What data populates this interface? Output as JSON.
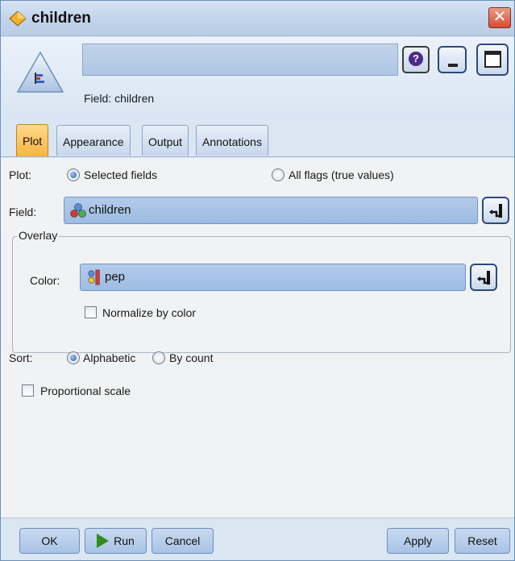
{
  "window": {
    "title": "children",
    "close_label": "✕"
  },
  "header": {
    "node_name_value": "",
    "help_label": "?",
    "field_caption": "Field: children"
  },
  "tabs": [
    {
      "label": "Plot",
      "active": true
    },
    {
      "label": "Appearance",
      "active": false
    },
    {
      "label": "Output",
      "active": false
    },
    {
      "label": "Annotations",
      "active": false
    }
  ],
  "plot": {
    "label": "Plot:",
    "options": [
      {
        "label": "Selected fields",
        "checked": true
      },
      {
        "label": "All flags (true values)",
        "checked": false
      }
    ]
  },
  "field": {
    "label": "Field:",
    "value": "children",
    "icon": "set-field-icon"
  },
  "overlay": {
    "legend": "Overlay",
    "color_label": "Color:",
    "color_value": "pep",
    "color_icon": "flag-field-icon",
    "normalize_label": "Normalize by color",
    "normalize_checked": false
  },
  "sort": {
    "label": "Sort:",
    "options": [
      {
        "label": "Alphabetic",
        "checked": true
      },
      {
        "label": "By count",
        "checked": false
      }
    ]
  },
  "proportional": {
    "label": "Proportional scale",
    "checked": false
  },
  "footer": {
    "ok": "OK",
    "run": "Run",
    "cancel": "Cancel",
    "apply": "Apply",
    "reset": "Reset"
  },
  "colors": {
    "active_tab": "#f7b541",
    "titlebar": "#c2d4ea",
    "run_icon": "#2f8e1e"
  }
}
